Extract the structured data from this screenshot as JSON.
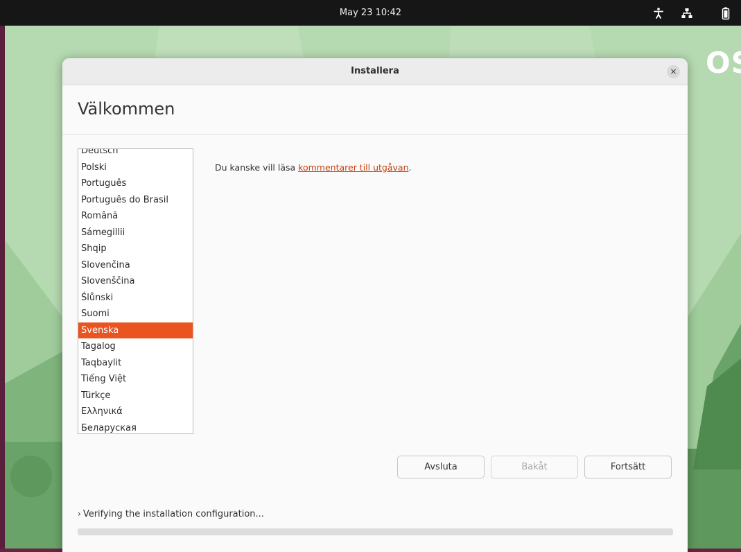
{
  "topbar": {
    "clock": "May 23  10:42",
    "icons": [
      "accessibility-icon",
      "network-icon",
      "battery-icon"
    ]
  },
  "desktop": {
    "logo_text": "OS"
  },
  "window": {
    "title": "Installera",
    "close_label": "×",
    "page_title": "Välkommen"
  },
  "language_list": {
    "items": [
      "Deutsch",
      "Polski",
      "Português",
      "Português do Brasil",
      "Română",
      "Sámegillii",
      "Shqip",
      "Slovenčina",
      "Slovenščina",
      "Ślůnski",
      "Suomi",
      "Svenska",
      "Tagalog",
      "Taqbaylit",
      "Tiếng Việt",
      "Türkçe",
      "Ελληνικά",
      "Беларуская"
    ],
    "selected": "Svenska"
  },
  "release_notes": {
    "prefix": "Du kanske vill läsa ",
    "link": "kommentarer till utgåvan",
    "suffix": "."
  },
  "buttons": {
    "quit": "Avsluta",
    "back": "Bakåt",
    "continue": "Fortsätt"
  },
  "progress": {
    "chevron": "›",
    "label": "Verifying the installation configuration...",
    "fraction": 0
  },
  "colors": {
    "accent": "#e95420",
    "link": "#c34113",
    "topbar": "#161616",
    "wallpaper": "#b9dcb4"
  }
}
